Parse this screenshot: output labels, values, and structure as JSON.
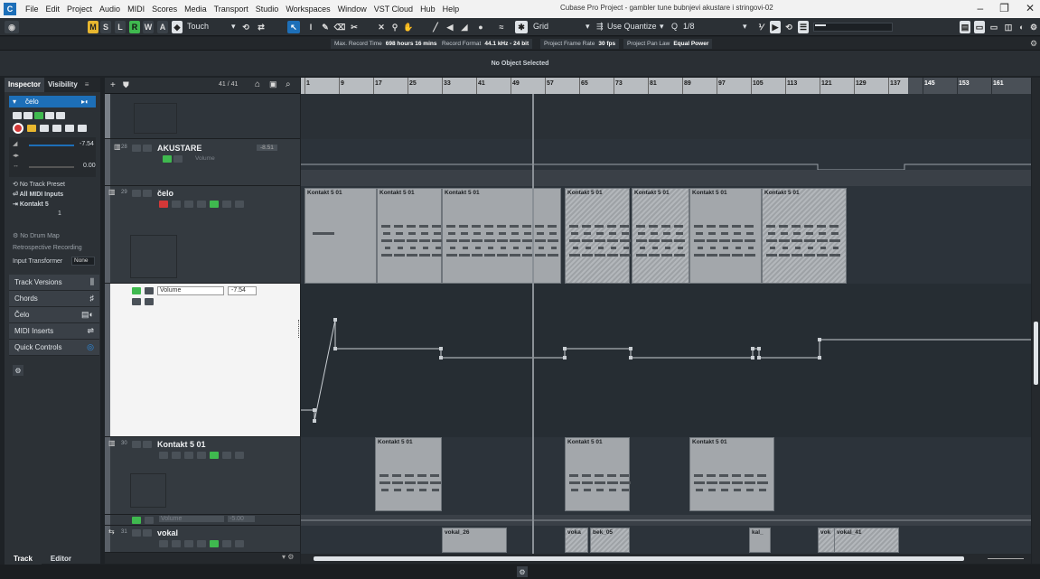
{
  "menubar": {
    "items": [
      "File",
      "Edit",
      "Project",
      "Audio",
      "MIDI",
      "Scores",
      "Media",
      "Transport",
      "Studio",
      "Workspaces",
      "Window",
      "VST Cloud",
      "Hub",
      "Help"
    ],
    "title": "Cubase Pro Project - gambler tune bubnjevi akustare i stringovi-02",
    "win_min": "–",
    "win_max": "❐",
    "win_close": "✕"
  },
  "toolbar": {
    "m": "M",
    "s": "S",
    "l": "L",
    "r": "R",
    "w": "W",
    "a": "A",
    "automation_mode": "Touch",
    "grid_type": "Grid",
    "quantize_preset": "Use Quantize",
    "quantize_value": "1/8"
  },
  "infobar": {
    "max_record_label": "Max. Record Time",
    "max_record_value": "698 hours 16 mins",
    "record_format_label": "Record Format",
    "record_format_value": "44.1 kHz - 24 bit",
    "frame_rate_label": "Project Frame Rate",
    "frame_rate_value": "30 fps",
    "pan_law_label": "Project Pan Law",
    "pan_law_value": "Equal Power"
  },
  "status": "No Object Selected",
  "inspector": {
    "tab_inspector": "Inspector",
    "tab_visibility": "Visibility",
    "track_name": "čelo",
    "volume": "-7.54",
    "pan": "0.00",
    "no_track_preset": "No Track Preset",
    "all_midi_inputs": "All MIDI Inputs",
    "output": "Kontakt 5",
    "channel": "1",
    "no_drum_map": "No Drum Map",
    "retro_recording": "Retrospective Recording",
    "input_transformer": "Input Transformer",
    "input_transformer_value": "None",
    "sections": [
      "Track Versions",
      "Chords",
      "Čelo",
      "MIDI Inserts",
      "Quick Controls"
    ],
    "bottom_tabs": [
      "Track",
      "Editor"
    ]
  },
  "tracklist": {
    "count": "41 / 41",
    "tracks": [
      {
        "num": "28",
        "name": "AKUSTARE",
        "lane": "Volume",
        "value": "-8.51"
      },
      {
        "num": "29",
        "name": "čelo",
        "lane": "Volume",
        "value": "-7.54"
      },
      {
        "num": "30",
        "name": "Kontakt 5 01",
        "lane": "Volume",
        "value": "-5.00"
      },
      {
        "num": "31",
        "name": "vokal"
      }
    ]
  },
  "ruler": {
    "marks": [
      "1",
      "9",
      "17",
      "25",
      "33",
      "41",
      "49",
      "57",
      "65",
      "73",
      "81",
      "89",
      "97",
      "105",
      "113",
      "121",
      "129",
      "137",
      "145",
      "153",
      "161"
    ]
  },
  "parts": {
    "celo": [
      "Kontakt 5 01",
      "Kontakt 5 01",
      "Kontakt 5 01",
      "Kontakt 5 01",
      "Kontakt 5 01",
      "Kontakt 5 01",
      "Kontakt 5 01"
    ],
    "kontakt": [
      "Kontakt 5 01",
      "Kontakt 5 01",
      "Kontakt 5 01"
    ],
    "vokal": [
      "vokal_26",
      "voka",
      "bek_05",
      "kal_",
      "vok",
      "vokal_41"
    ]
  },
  "colors": {
    "accent_green": "#3fb94f",
    "record_red": "#d33838",
    "part_grey": "#a3a7ab",
    "background": "#2c333a"
  }
}
